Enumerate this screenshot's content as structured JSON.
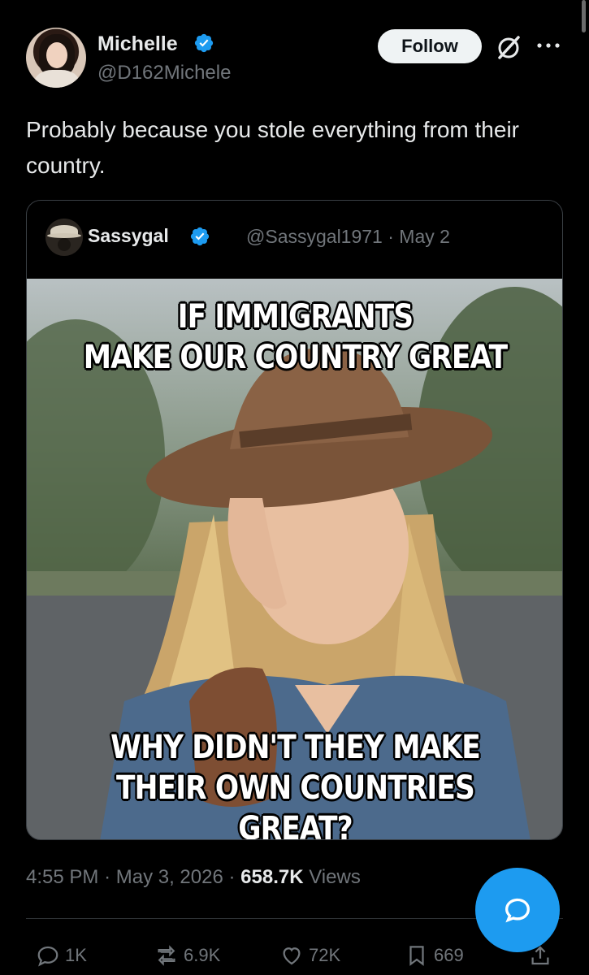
{
  "post": {
    "author_name": "Michelle",
    "author_handle": "@D162Michele",
    "follow_label": "Follow",
    "more_icon": "more-icon",
    "text": "Probably because you stole everything from their country."
  },
  "quote": {
    "author_name": "Sassygal",
    "author_handle": "@Sassygal1971",
    "date": "· May 2",
    "meme_top_line1": "IF IMMIGRANTS",
    "meme_top_line2": "MAKE OUR COUNTRY GREAT",
    "meme_bottom_line1": "WHY DIDN'T THEY MAKE",
    "meme_bottom_line2": "THEIR OWN COUNTRIES GREAT?"
  },
  "meta": {
    "time": "4:55 PM",
    "sep1": "·",
    "date": "May 3, 2026",
    "sep2": "·",
    "views_count": "658.7K",
    "views_label": "Views"
  },
  "actions": {
    "replies": "1K",
    "reposts": "6.9K",
    "likes": "72K",
    "bookmarks": "669"
  },
  "colors": {
    "accent": "#1d9bf0",
    "background": "#000000",
    "muted": "#71767b"
  }
}
